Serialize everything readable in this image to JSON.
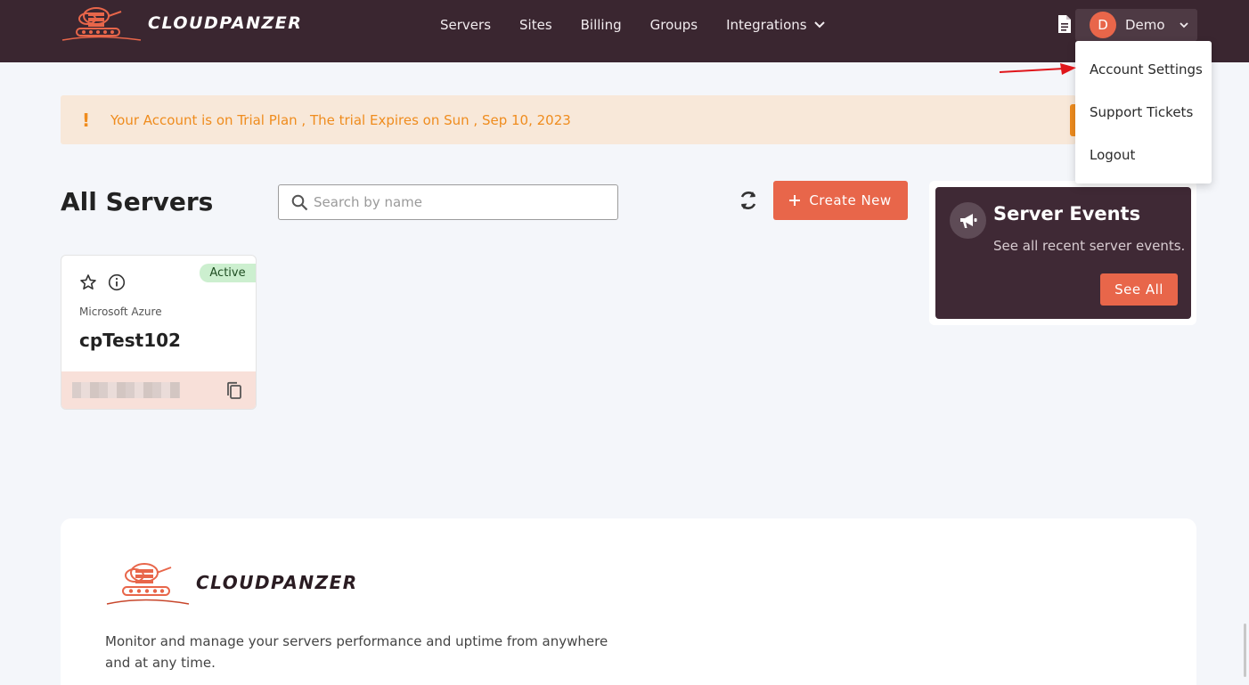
{
  "brand": {
    "name": "CLOUDPANZER"
  },
  "nav": {
    "items": [
      {
        "label": "Servers"
      },
      {
        "label": "Sites"
      },
      {
        "label": "Billing"
      },
      {
        "label": "Groups"
      },
      {
        "label": "Integrations",
        "has_dropdown": true
      }
    ]
  },
  "user": {
    "initial": "D",
    "name": "Demo",
    "menu": [
      {
        "label": "Account Settings"
      },
      {
        "label": "Support Tickets"
      },
      {
        "label": "Logout"
      }
    ]
  },
  "banner": {
    "icon": "!",
    "text": "Your Account is on Trial Plan , The trial Expires on Sun , Sep 10, 2023"
  },
  "servers": {
    "title": "All Servers",
    "search_placeholder": "Search by name",
    "search_value": "",
    "create_label": "Create New",
    "cards": [
      {
        "status": "Active",
        "provider": "Microsoft Azure",
        "name": "cpTest102"
      }
    ]
  },
  "events": {
    "title": "Server Events",
    "subtitle": "See all recent server events.",
    "button": "See All"
  },
  "footer": {
    "brand": "CLOUDPANZER",
    "description": "Monitor and manage your servers performance and uptime from anywhere and at any time."
  },
  "colors": {
    "topbar": "#3a2630",
    "accent": "#e8664a",
    "warning": "#ef8c1e",
    "banner_bg": "#f8e8d9",
    "active_badge": "#ccefcf",
    "events_bg": "#3f2935"
  }
}
